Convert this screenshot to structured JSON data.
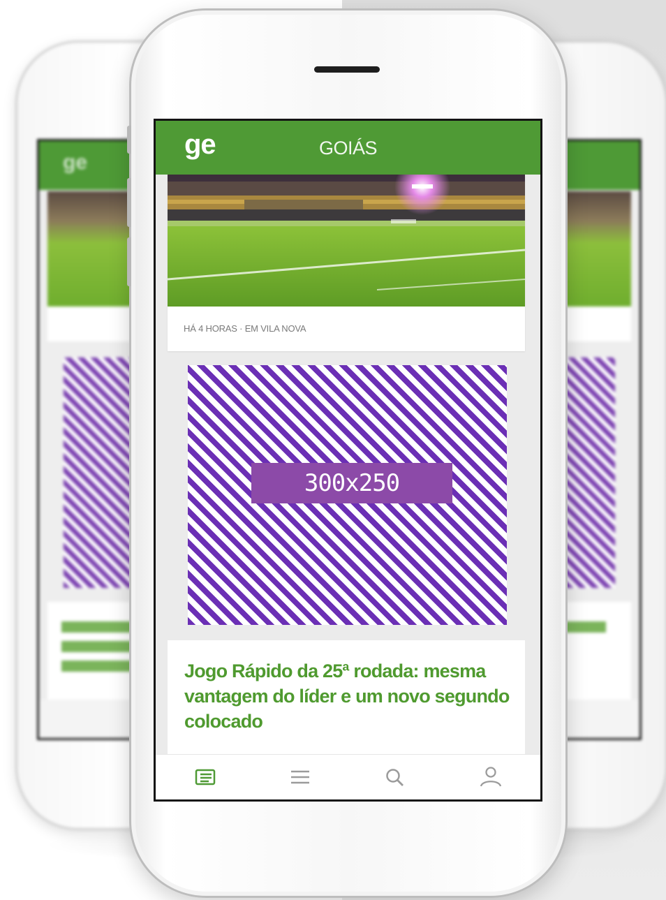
{
  "app": {
    "logo": "ge",
    "section_title": "GOIÁS"
  },
  "news_card": {
    "image": "stadium-photo",
    "meta": "HÁ 4 HORAS  ·  EM VILA NOVA"
  },
  "ad": {
    "label": "300x250"
  },
  "headline_card": {
    "title": "Jogo Rápido da 25ª rodada: mesma vantagem do líder e um novo segundo colocado"
  },
  "bottom_nav": {
    "items": [
      {
        "icon": "news-icon",
        "active": true
      },
      {
        "icon": "menu-icon",
        "active": false
      },
      {
        "icon": "search-icon",
        "active": false
      },
      {
        "icon": "user-icon",
        "active": false
      }
    ]
  },
  "colors": {
    "brand_green": "#4f9a35",
    "headline_green": "#4f9a2f",
    "ad_purple": "#6b2fb5",
    "ad_label_bg": "#8c4aa8"
  }
}
